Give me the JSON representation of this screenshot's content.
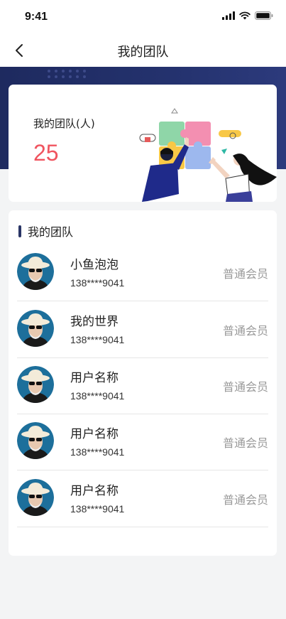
{
  "status_bar": {
    "time": "9:41"
  },
  "nav": {
    "title": "我的团队"
  },
  "summary": {
    "label": "我的团队(人)",
    "count": "25"
  },
  "section": {
    "title": "我的团队"
  },
  "members": [
    {
      "name": "小鱼泡泡",
      "phone": "138****9041",
      "level": "普通会员"
    },
    {
      "name": "我的世界",
      "phone": "138****9041",
      "level": "普通会员"
    },
    {
      "name": "用户名称",
      "phone": "138****9041",
      "level": "普通会员"
    },
    {
      "name": "用户名称",
      "phone": "138****9041",
      "level": "普通会员"
    },
    {
      "name": "用户名称",
      "phone": "138****9041",
      "level": "普通会员"
    }
  ],
  "icons": {
    "back": "chevron-left-icon",
    "signal": "signal-icon",
    "wifi": "wifi-icon",
    "battery": "battery-icon"
  },
  "colors": {
    "accent_count": "#f0545f",
    "hero_bg": "#24326e",
    "section_bar": "#2a3566",
    "level_text": "#999999"
  }
}
